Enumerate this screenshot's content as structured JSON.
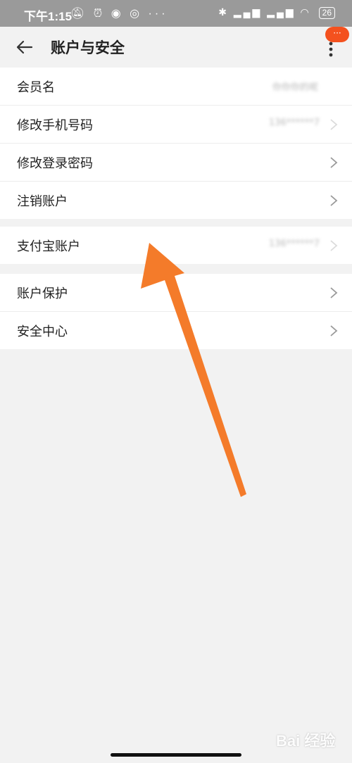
{
  "status_bar": {
    "time": "下午1:15",
    "left_icons": [
      "mute-icon",
      "alarm-icon",
      "app-notification-icon",
      "app-notification-icon",
      "more-notifications-icon"
    ],
    "more": "···",
    "right_icons": [
      "bluetooth-icon",
      "signal-icon",
      "signal-icon",
      "wifi-icon"
    ],
    "battery": "26"
  },
  "app_bar": {
    "title": "账户与安全",
    "badge": "···"
  },
  "groups": [
    {
      "rows": [
        {
          "label": "会员名",
          "value": "你你你的呢",
          "chevron": false
        },
        {
          "label": "修改手机号码",
          "value": "136******7",
          "chevron": true
        },
        {
          "label": "修改登录密码",
          "value": "",
          "chevron": true
        },
        {
          "label": "注销账户",
          "value": "",
          "chevron": true
        }
      ]
    },
    {
      "rows": [
        {
          "label": "支付宝账户",
          "value": "136******7",
          "chevron": true
        }
      ]
    },
    {
      "rows": [
        {
          "label": "账户保护",
          "value": "",
          "chevron": true
        },
        {
          "label": "安全中心",
          "value": "",
          "chevron": true
        }
      ]
    }
  ],
  "annotation": {
    "arrow_color": "#f47b2a"
  },
  "watermark": {
    "text": "Bai 经验"
  },
  "colors": {
    "accent": "#f4511e",
    "status_bar_bg": "#9a9a9a",
    "page_bg": "#f2f2f2"
  }
}
